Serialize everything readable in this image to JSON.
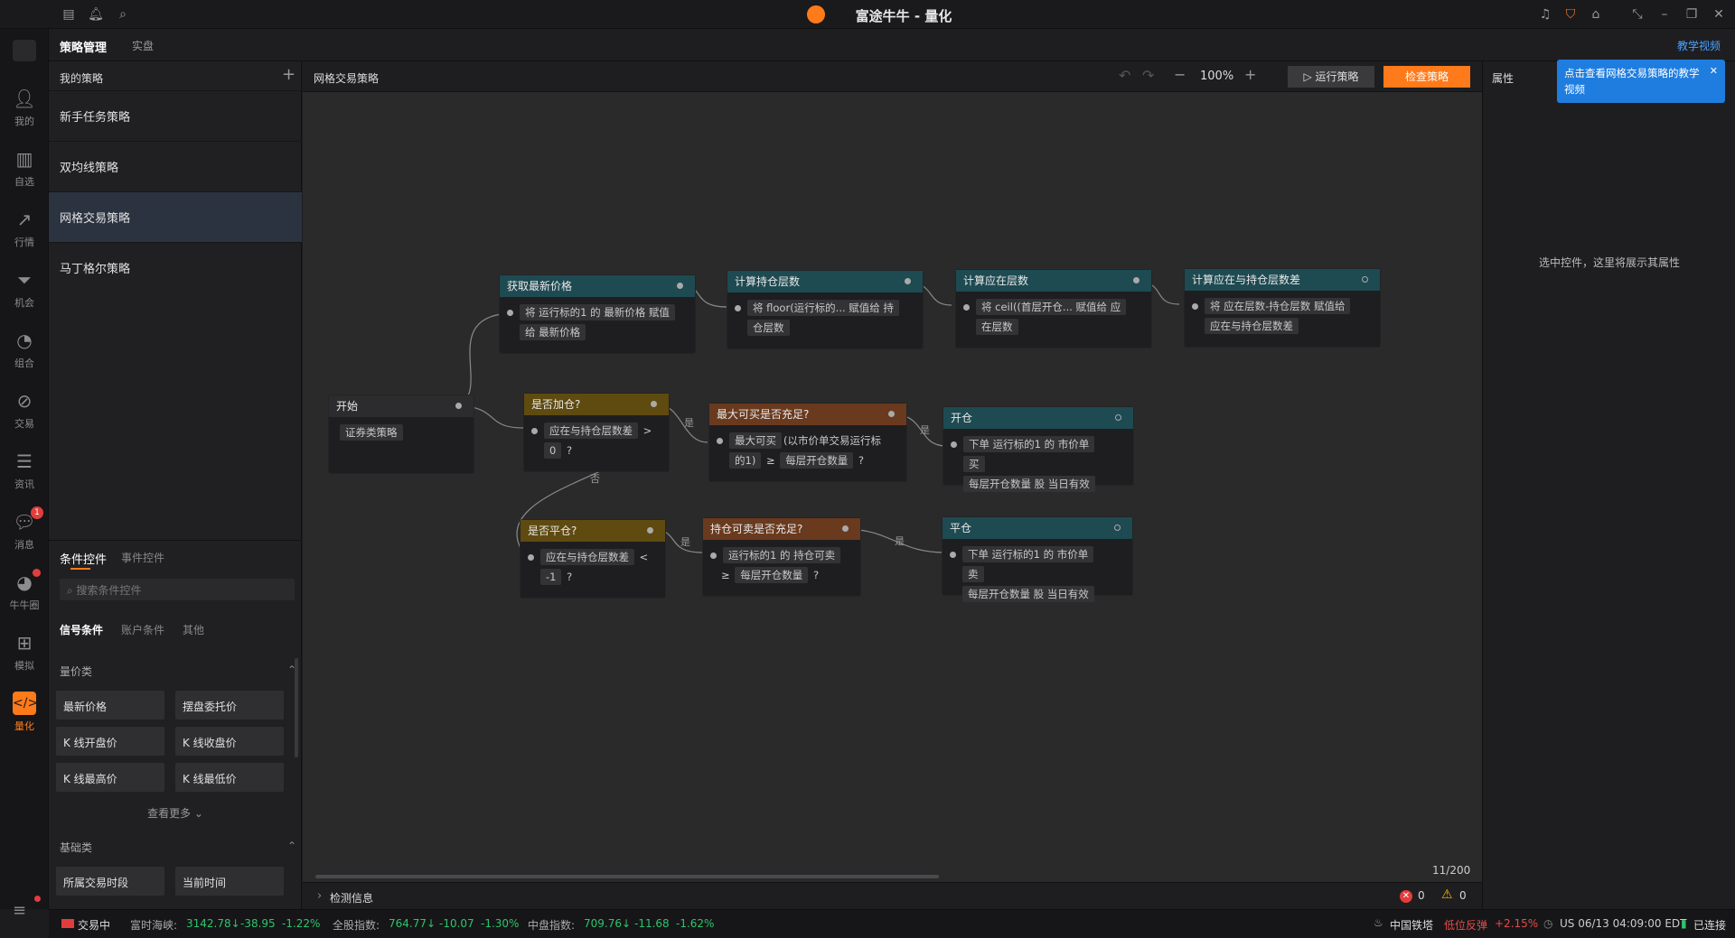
{
  "window": {
    "title": "富途牛牛 - 量化"
  },
  "rail": [
    {
      "label": "我的",
      "icon": "user-icon"
    },
    {
      "label": "自选",
      "icon": "bar-chart-icon"
    },
    {
      "label": "行情",
      "icon": "trend-icon"
    },
    {
      "label": "机会",
      "icon": "funnel-icon"
    },
    {
      "label": "组合",
      "icon": "pie-icon"
    },
    {
      "label": "交易",
      "icon": "trade-icon"
    },
    {
      "label": "资讯",
      "icon": "news-icon"
    },
    {
      "label": "消息",
      "icon": "chat-icon",
      "badge": "1"
    },
    {
      "label": "牛牛圈",
      "icon": "circle-icon"
    },
    {
      "label": "模拟",
      "icon": "gamepad-icon"
    },
    {
      "label": "量化",
      "icon": "code-icon"
    }
  ],
  "tabs": {
    "manage": "策略管理",
    "live": "实盘",
    "tutorial": "教学视频"
  },
  "strategies": {
    "header": "我的策略",
    "add": "+",
    "items": [
      "新手任务策略",
      "双均线策略",
      "网格交易策略",
      "马丁格尔策略"
    ]
  },
  "controls": {
    "tab1": "条件控件",
    "tab2": "事件控件",
    "search_placeholder": "搜索条件控件",
    "sub1": "信号条件",
    "sub2": "账户条件",
    "sub3": "其他",
    "cat1": "量价类",
    "cat1_items": [
      "最新价格",
      "摆盘委托价",
      "K 线开盘价",
      "K 线收盘价",
      "K 线最高价",
      "K 线最低价"
    ],
    "more": "查看更多 ⌄",
    "cat2": "基础类",
    "cat2_items": [
      "所属交易时段",
      "当前时间"
    ]
  },
  "canvas": {
    "title": "网格交易策略",
    "zoom": "100%",
    "run": "运行策略",
    "check": "检查策略",
    "count": "11/200",
    "check_info": "检测信息",
    "errors": "0",
    "warnings": "0"
  },
  "nodes": {
    "start": {
      "title": "开始",
      "chips": [
        "证券类策略"
      ]
    },
    "get_price": {
      "title": "获取最新价格",
      "line1": [
        "将 运行标的1 的 最新价格 赋值"
      ],
      "line2": [
        "给 最新价格"
      ]
    },
    "calc_hold": {
      "title": "计算持仓层数",
      "line1": [
        "将 floor(运行标的... 赋值给 持"
      ],
      "line2": [
        "仓层数"
      ]
    },
    "calc_should": {
      "title": "计算应在层数",
      "line1": [
        "将 ceil((首层开仓... 赋值给 应"
      ],
      "line2": [
        "在层数"
      ]
    },
    "calc_diff": {
      "title": "计算应在与持仓层数差",
      "line1": [
        "将 应在层数-持仓层数 赋值给"
      ],
      "line2": [
        "应在与持仓层数差"
      ]
    },
    "add_pos": {
      "title": "是否加仓?",
      "line1": [
        "应在与持仓层数差",
        ">"
      ],
      "line2": [
        "0",
        "?"
      ]
    },
    "max_buy": {
      "title": "最大可买是否充足?",
      "line1": [
        "最大可买",
        "(以市价单交易运行标"
      ],
      "line2": [
        "的1)",
        "≥",
        "每层开仓数量",
        "?"
      ]
    },
    "open": {
      "title": "开仓",
      "line1": [
        "下单 运行标的1 的 市价单",
        "买"
      ],
      "line2": [
        "每层开仓数量 股 当日有效"
      ]
    },
    "close_pos": {
      "title": "是否平仓?",
      "line1": [
        "应在与持仓层数差",
        "<"
      ],
      "line2": [
        "-1",
        "?"
      ]
    },
    "sell_ok": {
      "title": "持仓可卖是否充足?",
      "line1": [
        "运行标的1 的 持仓可卖"
      ],
      "line2": [
        "≥",
        "每层开仓数量",
        "?"
      ]
    },
    "close": {
      "title": "平仓",
      "line1": [
        "下单 运行标的1 的 市价单",
        "卖"
      ],
      "line2": [
        "每层开仓数量 股 当日有效"
      ]
    }
  },
  "edges": {
    "yes": "是",
    "no": "否"
  },
  "properties": {
    "title": "属性",
    "empty": "选中控件，这里将展示其属性",
    "tooltip": "点击查看网格交易策略的教学视频",
    "close": "✕"
  },
  "status": {
    "trading": "交易中",
    "idx1_name": "富时海峡:",
    "idx1_val": "3142.78↓",
    "idx1_chg": "-38.95",
    "idx1_pct": "-1.22%",
    "idx2_name": "全股指数:",
    "idx2_val": "764.77↓",
    "idx2_chg": "-10.07",
    "idx2_pct": "-1.30%",
    "idx3_name": "中盘指数:",
    "idx3_val": "709.76↓",
    "idx3_chg": "-11.68",
    "idx3_pct": "-1.62%",
    "stock": "中国铁塔",
    "stock_note": "低位反弹",
    "stock_pct": "+2.15%",
    "time": "US 06/13 04:09:00 EDT",
    "connected": "已连接"
  },
  "colors": {
    "accent": "#ff7a1a",
    "up": "#2ec46b",
    "down": "#e64b4b",
    "link": "#4aa3ff"
  }
}
